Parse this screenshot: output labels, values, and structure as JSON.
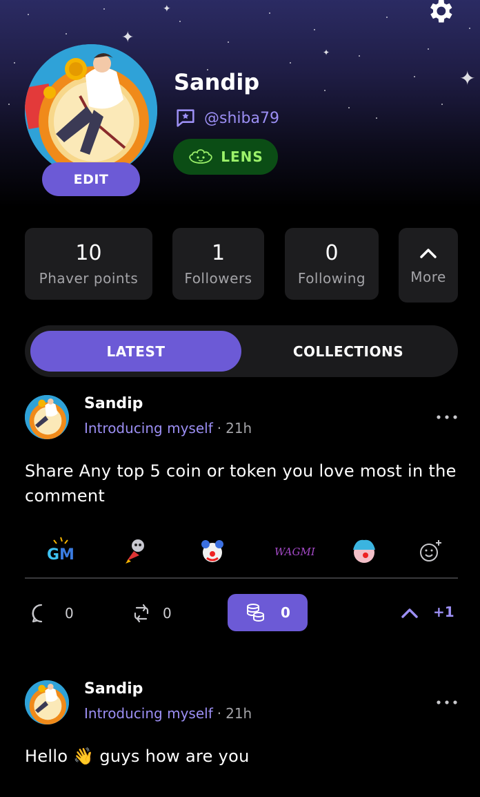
{
  "profile": {
    "name": "Sandip",
    "handle": "@shiba79",
    "badge_label": "LENS",
    "edit_label": "EDIT"
  },
  "stats": [
    {
      "value": "10",
      "label": "Phaver points"
    },
    {
      "value": "1",
      "label": "Followers"
    },
    {
      "value": "0",
      "label": "Following"
    }
  ],
  "more_label": "More",
  "tabs": [
    {
      "label": "LATEST",
      "active": true
    },
    {
      "label": "COLLECTIONS",
      "active": false
    }
  ],
  "posts": [
    {
      "author": "Sandip",
      "category": "Introducing myself",
      "separator": "·",
      "time": "21h",
      "text": "Share Any top 5 coin or token you love most in the comment",
      "reactions": [
        "GM",
        "rocket-skull",
        "clown",
        "WAGMI",
        "wojak-clown",
        "add-reaction"
      ],
      "comments": "0",
      "reposts": "0",
      "tips": "0",
      "votes": "+1"
    },
    {
      "author": "Sandip",
      "category": "Introducing myself",
      "separator": "·",
      "time": "21h",
      "text": "Hello 👋 guys how are you"
    }
  ],
  "colors": {
    "accent": "#6c5ad6",
    "accent_text": "#9c8ff4",
    "lens_bg": "#0b4d15",
    "lens_text": "#9bf16a",
    "card_bg": "#1d1d1f"
  }
}
